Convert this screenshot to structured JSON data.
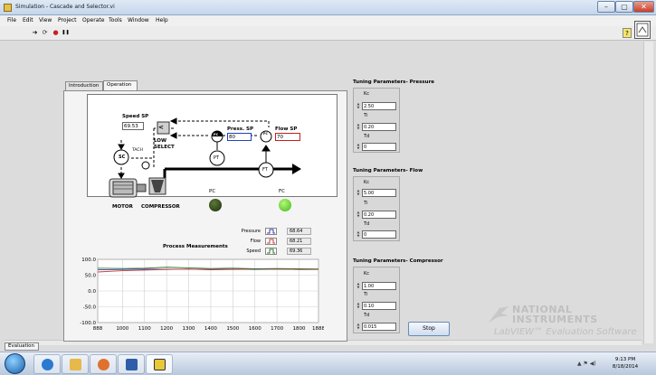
{
  "window": {
    "title": "Simulation - Cascade and Selector.vi",
    "min_glyph": "–",
    "max_glyph": "▢",
    "close_glyph": "✕"
  },
  "menu": [
    "File",
    "Edit",
    "View",
    "Project",
    "Operate",
    "Tools",
    "Window",
    "Help"
  ],
  "toolbar": {
    "run_arrow_icon": "➔",
    "run_continuous_icon": "⟳",
    "abort_icon": "●",
    "pause_icon": "❚❚",
    "help_glyph": "?"
  },
  "tabs": [
    "Introduction",
    "Operation"
  ],
  "process": {
    "speed_sp_label": "Speed SP",
    "speed_sp_value": "69.53",
    "low_select_symbol": "<",
    "low_select_label_1": "LOW",
    "low_select_label_2": "SELECT",
    "press_sp_label": "Press. SP",
    "press_sp_value": "80",
    "flow_sp_label": "Flow SP",
    "flow_sp_value": "70",
    "pc_tag": "PC",
    "fc_tag": "FC",
    "sc_tag": "SC",
    "tach_label": "TACH",
    "pt_tag": "PT",
    "ft_tag": "FT",
    "motor_label": "MOTOR",
    "compressor_label": "COMPRESSOR",
    "pc_led_label": "PC",
    "fc_led_label": "FC"
  },
  "chart": {
    "title": "Process Measurements",
    "legend": [
      {
        "name": "Pressure",
        "value": "68.64",
        "color": "#3a3aa8"
      },
      {
        "name": "Flow",
        "value": "68.21",
        "color": "#c83a3a"
      },
      {
        "name": "Speed",
        "value": "69.36",
        "color": "#2e7a2e"
      }
    ]
  },
  "chart_data": {
    "type": "line",
    "title": "Process Measurements",
    "xlim": [
      888,
      1888
    ],
    "ylim": [
      -100,
      100
    ],
    "x_ticks": [
      "888",
      "1000",
      "1100",
      "1200",
      "1300",
      "1400",
      "1500",
      "1600",
      "1700",
      "1800",
      "1888"
    ],
    "y_ticks": [
      "100.0",
      "50.0",
      "0.0",
      "-50.0",
      "-100.0"
    ],
    "grid": true,
    "series": [
      {
        "name": "Pressure",
        "x": [
          888,
          1000,
          1100,
          1200,
          1300,
          1400,
          1500,
          1600,
          1700,
          1800,
          1888
        ],
        "values": [
          67,
          68,
          69,
          68,
          69,
          68,
          69,
          68,
          69,
          68,
          68.6
        ]
      },
      {
        "name": "Flow",
        "x": [
          888,
          1000,
          1100,
          1200,
          1300,
          1400,
          1500,
          1600,
          1700,
          1800,
          1888
        ],
        "values": [
          60,
          64,
          66,
          68,
          69,
          67,
          68,
          69,
          69,
          68,
          68.2
        ]
      },
      {
        "name": "Speed",
        "x": [
          888,
          1000,
          1100,
          1200,
          1300,
          1400,
          1500,
          1600,
          1700,
          1800,
          1888
        ],
        "values": [
          72,
          71,
          72,
          75,
          73,
          71,
          72,
          70,
          71,
          70,
          69.4
        ]
      }
    ]
  },
  "tuning": [
    {
      "title": "Tuning Parameters- Pressure",
      "kc_label": "Kc",
      "kc": "2.50",
      "ti_label": "Ti",
      "ti": "0.20",
      "td_label": "Td",
      "td": "0"
    },
    {
      "title": "Tuning Parameters- Flow",
      "kc_label": "Kc",
      "kc": "5.00",
      "ti_label": "Ti",
      "ti": "0.20",
      "td_label": "Td",
      "td": "0"
    },
    {
      "title": "Tuning Parameters- Compressor",
      "kc_label": "Kc",
      "kc": "1.00",
      "ti_label": "Ti",
      "ti": "0.10",
      "td_label": "Td",
      "td": "0.015"
    }
  ],
  "stop_label": "Stop",
  "brand": {
    "line1": "NATIONAL",
    "line2": "INSTRUMENTS",
    "line3": "LabVIEW™ Evaluation Software"
  },
  "eval_tab": "Evaluation",
  "taskbar": {
    "time": "9:13 PM",
    "date": "8/18/2014",
    "tray": "▲ ⚑ ◀)"
  }
}
